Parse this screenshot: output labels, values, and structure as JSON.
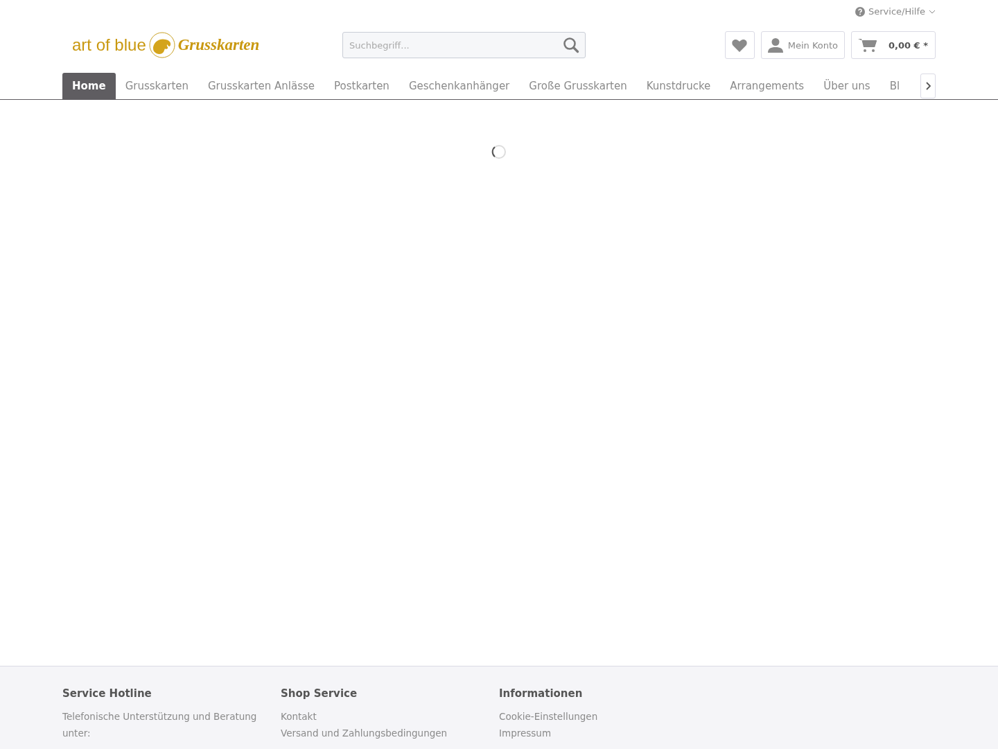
{
  "top_bar": {
    "service_menu": "Service/Hilfe"
  },
  "logo": {
    "brand": "art of blue",
    "tagline": "Grusskarten"
  },
  "search": {
    "placeholder": "Suchbegriff..."
  },
  "account": {
    "label": "Mein Konto"
  },
  "cart": {
    "total": "0,00 € *"
  },
  "nav": [
    {
      "label": "Home",
      "selected": true
    },
    {
      "label": "Grusskarten",
      "selected": false
    },
    {
      "label": "Grusskarten Anlässe",
      "selected": false
    },
    {
      "label": "Postkarten",
      "selected": false
    },
    {
      "label": "Geschenkanhänger",
      "selected": false
    },
    {
      "label": "Große Grusskarten",
      "selected": false
    },
    {
      "label": "Kunstdrucke",
      "selected": false
    },
    {
      "label": "Arrangements",
      "selected": false
    },
    {
      "label": "Über uns",
      "selected": false
    },
    {
      "label": "Bl",
      "selected": false
    }
  ],
  "footer": [
    {
      "title": "Service Hotline",
      "text": "Telefonische Unterstützung und Beratung unter:"
    },
    {
      "title": "Shop Service",
      "links": [
        "Kontakt",
        "Versand und Zahlungsbedingungen"
      ]
    },
    {
      "title": "Informationen",
      "links": [
        "Cookie-Einstellungen",
        "Impressum"
      ]
    }
  ]
}
